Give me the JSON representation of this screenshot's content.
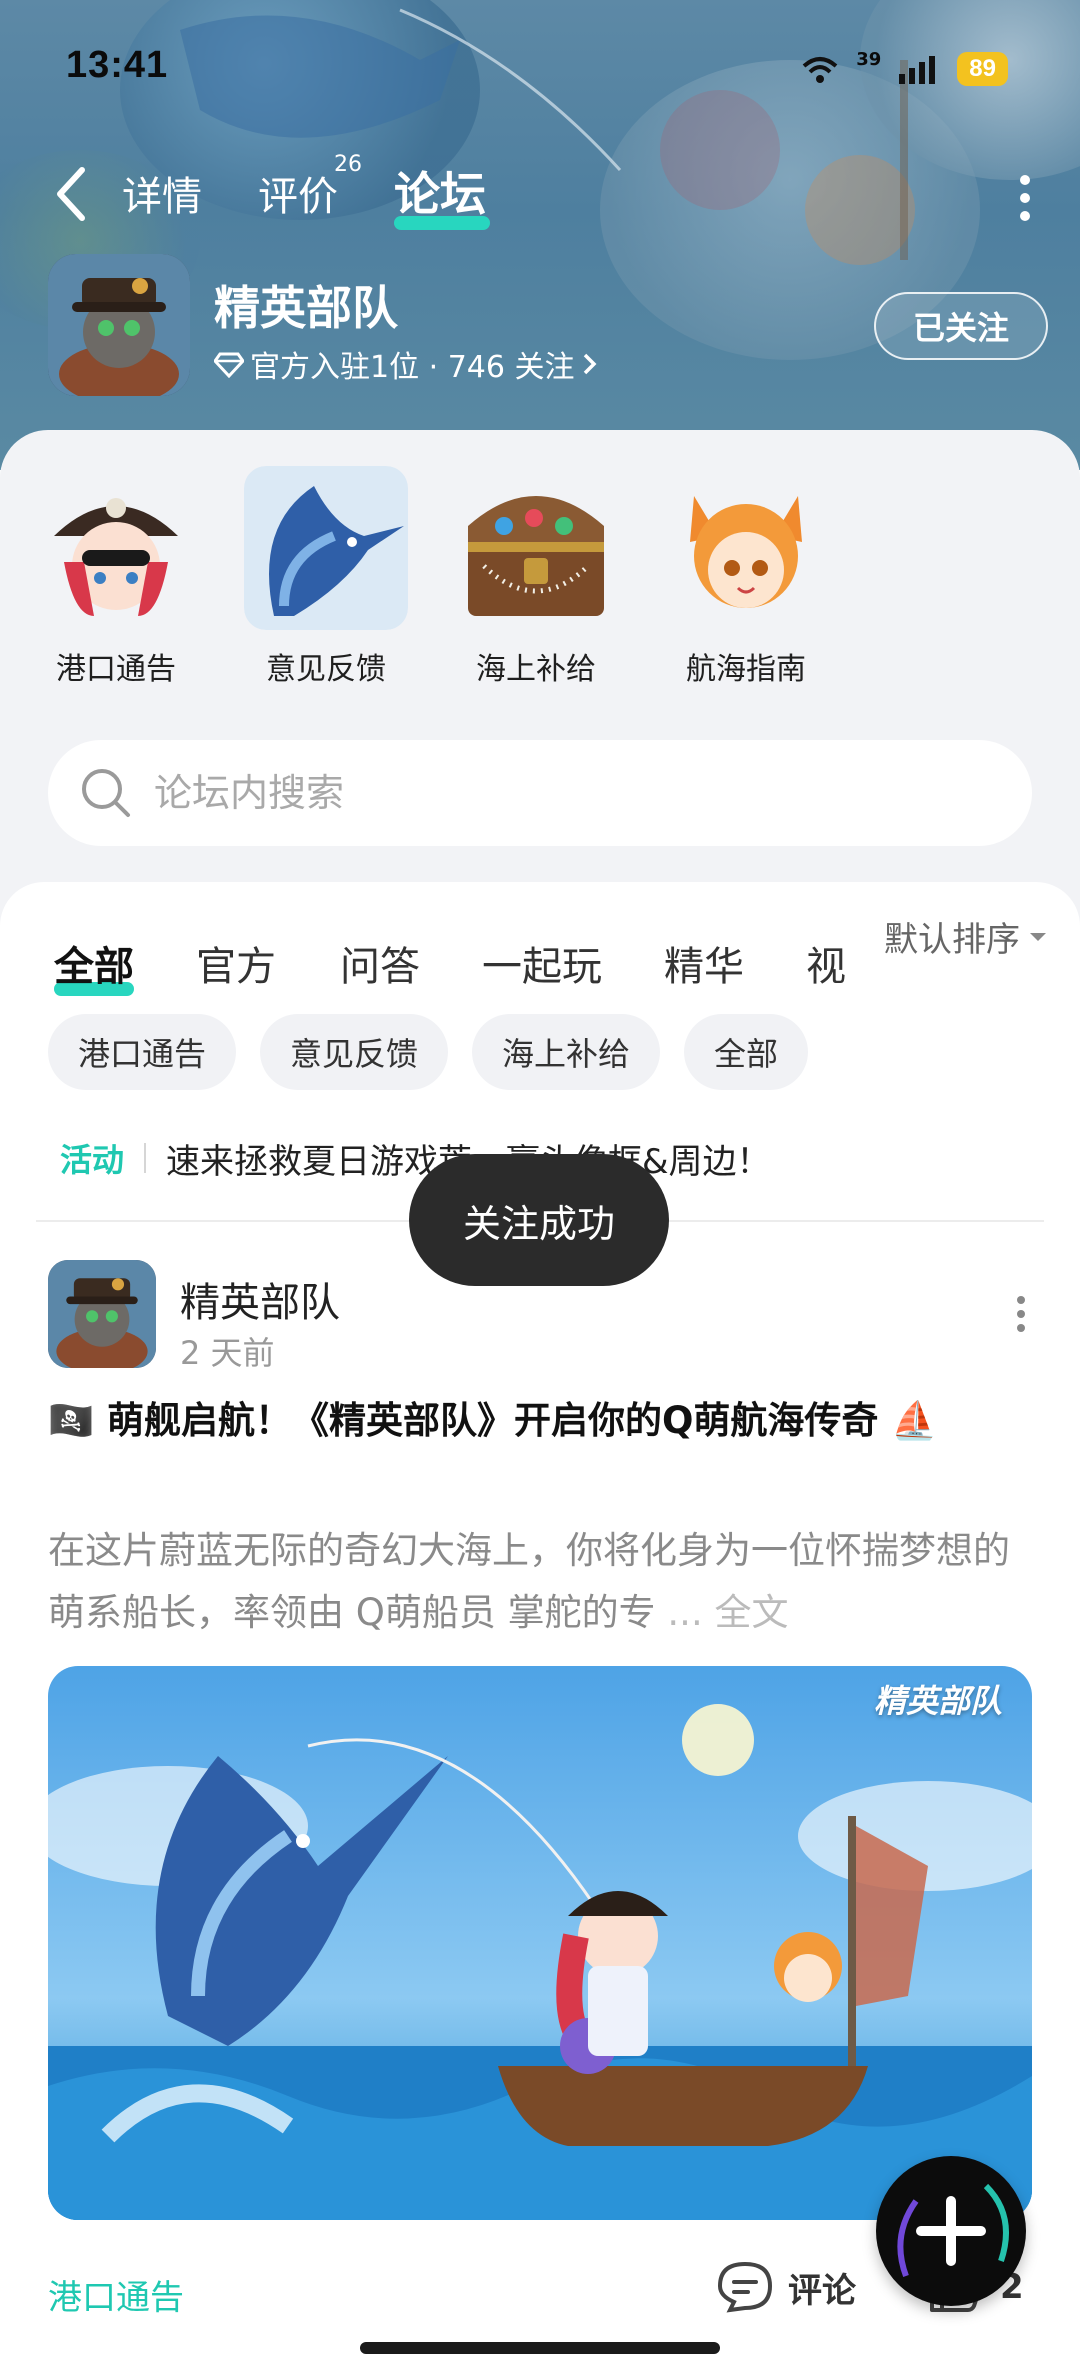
{
  "status_bar": {
    "time": "13:41",
    "signal_label": "39",
    "battery": "89"
  },
  "nav": {
    "tabs": [
      {
        "label": "详情"
      },
      {
        "label": "评价",
        "badge": "26"
      },
      {
        "label": "论坛"
      }
    ],
    "active_tab": "论坛"
  },
  "game": {
    "name": "精英部队",
    "meta": "官方入驻1位 · 746 关注",
    "follow_label": "已关注"
  },
  "sections": [
    {
      "label": "港口通告"
    },
    {
      "label": "意见反馈"
    },
    {
      "label": "海上补给"
    },
    {
      "label": "航海指南"
    }
  ],
  "search": {
    "placeholder": "论坛内搜索"
  },
  "filter_tabs": [
    {
      "label": "全部"
    },
    {
      "label": "官方"
    },
    {
      "label": "问答"
    },
    {
      "label": "一起玩"
    },
    {
      "label": "精华"
    },
    {
      "label": "视"
    }
  ],
  "sort": {
    "label": "默认排序"
  },
  "chips": [
    {
      "label": "港口通告"
    },
    {
      "label": "意见反馈"
    },
    {
      "label": "海上补给"
    },
    {
      "label": "全部"
    }
  ],
  "announcement": {
    "tag": "活动",
    "text": "速来拯救夏日游戏荒，赢头像框&周边！"
  },
  "toast": {
    "text": "关注成功"
  },
  "post": {
    "author": "精英部队",
    "time": "2 天前",
    "title": "🏴‍☠️ 萌舰启航！《精英部队》开启你的Q萌航海传奇 ⛵",
    "body": "在这片蔚蓝无际的奇幻大海上，你将化身为一位怀揣梦想的 萌系船长，率领由 Q萌船员 掌舵的专",
    "more_label": "... 全文",
    "image_watermark": "精英部队",
    "tag": "港口通告",
    "comment_label": "评论",
    "like_count": "2"
  },
  "colors": {
    "accent": "#28d6bf",
    "tag": "#1fc8b1",
    "battery": "#f3c21f"
  }
}
